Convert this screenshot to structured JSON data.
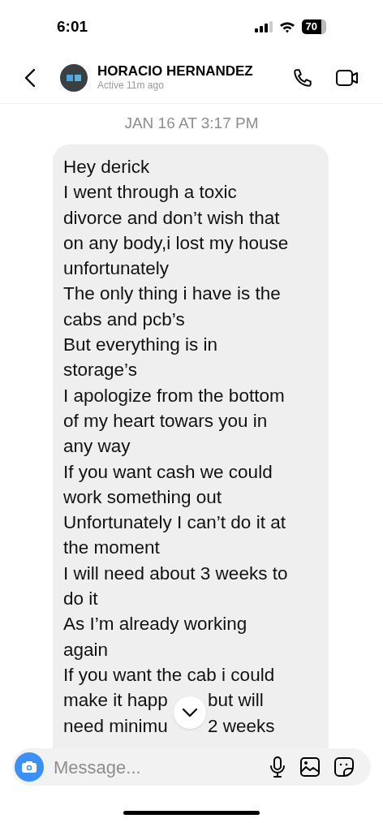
{
  "status_bar": {
    "time": "6:01",
    "battery": "70"
  },
  "header": {
    "name": "HORACIO HERNANDEZ",
    "status": "Active 11m ago"
  },
  "date_separator": "JAN 16 AT 3:17 PM",
  "message": {
    "lines": [
      "Hey derick",
      "I went through a toxic",
      "divorce and don’t wish that",
      "on any body,i lost my house",
      "unfortunately",
      "The only thing i have is the",
      "cabs and pcb’s",
      "But everything is in",
      "storage’s",
      "I apologize from the bottom",
      "of my heart towars you in",
      "any way",
      "If you want cash we could",
      "work something out",
      "Unfortunately I can’t do it at",
      "the moment",
      "I will need about 3 weeks to",
      "do it",
      "As I’m already working",
      "again",
      "If you want the cab i could",
      {
        "parts": [
          "make it happ",
          "but will"
        ]
      },
      {
        "parts": [
          "need minimu",
          "2 weeks"
        ]
      }
    ]
  },
  "composer": {
    "placeholder": "Message..."
  }
}
